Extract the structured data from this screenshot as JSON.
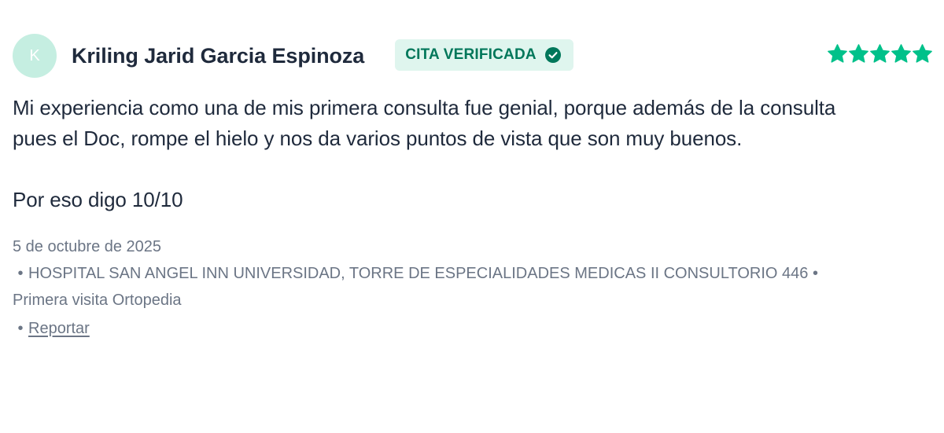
{
  "review": {
    "avatar_initial": "K",
    "author_name": "Kriling Jarid Garcia Espinoza",
    "badge_label": "CITA VERIFICADA",
    "rating": 5,
    "rating_max": 5,
    "body": {
      "line1": "Mi experiencia como una de mis primera consulta fue genial, porque además de la consulta",
      "line2": "pues el Doc, rompe el hielo y nos da varios puntos de vista que son muy buenos.",
      "line3": "Por eso digo 10/10"
    },
    "date": "5 de octubre de 2025",
    "location_bullet": "•",
    "location": "HOSPITAL SAN ANGEL INN UNIVERSIDAD, TORRE DE ESPECIALIDADES MEDICAS II CONSULTORIO 446",
    "visit_bullet": "•",
    "visit_type": "Primera visita Ortopedia",
    "report_bullet": "•",
    "report_label": "Reportar"
  },
  "colors": {
    "avatar_bg": "#c5eee1",
    "badge_bg": "#dff5ee",
    "badge_text": "#00775a",
    "star": "#00c18a",
    "text_primary": "#1f2a3c",
    "text_muted": "#6b7585"
  },
  "icons": {
    "badge_icon": "check-circle-icon",
    "rating_icon": "star-icon"
  }
}
